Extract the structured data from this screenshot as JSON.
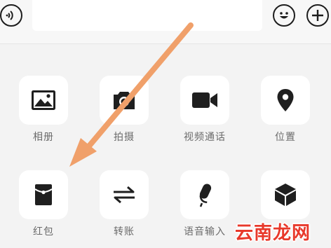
{
  "toolbar": {
    "voice_icon": "voice-toggle-icon",
    "emoji_icon": "smiley-icon",
    "plus_icon": "plus-icon",
    "input_value": ""
  },
  "panel": {
    "items": [
      {
        "label": "相册",
        "icon": "image-icon"
      },
      {
        "label": "拍摄",
        "icon": "camera-icon"
      },
      {
        "label": "视频通话",
        "icon": "video-camera-icon"
      },
      {
        "label": "位置",
        "icon": "location-pin-icon"
      },
      {
        "label": "红包",
        "icon": "red-packet-icon"
      },
      {
        "label": "转账",
        "icon": "transfer-icon"
      },
      {
        "label": "语音输入",
        "icon": "microphone-icon"
      },
      {
        "label": "",
        "icon": "cube-icon"
      }
    ]
  },
  "annotation": {
    "arrow_color": "#f0a06a"
  },
  "watermark": {
    "text": "云南龙网"
  }
}
